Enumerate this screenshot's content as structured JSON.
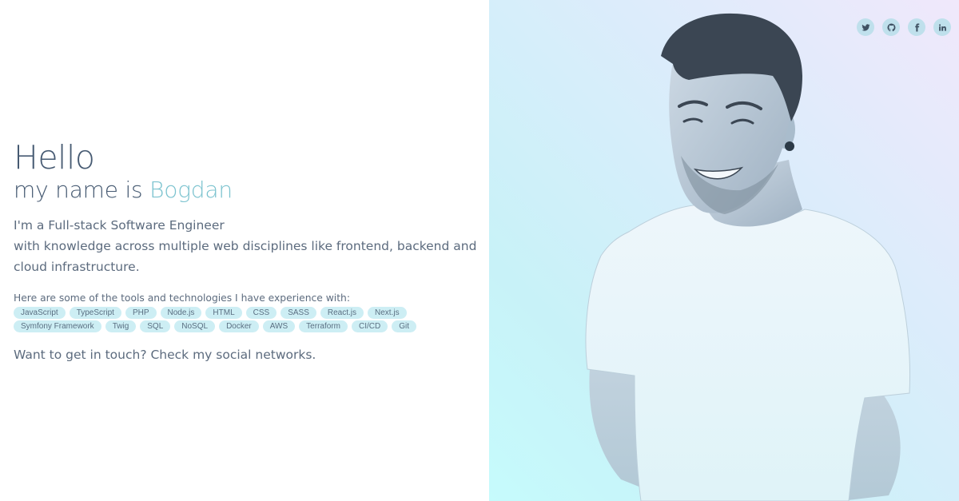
{
  "hero": {
    "hello": "Hello",
    "name_prefix": "my name is",
    "name": "Bogdan",
    "role_line": "I'm a Full-stack Software Engineer",
    "desc_line": "with knowledge across multiple web disciplines like frontend, backend and cloud infrastructure.",
    "tools_label": "Here are some of the tools and technologies I have experience with:",
    "tags": [
      "JavaScript",
      "TypeScript",
      "PHP",
      "Node.js",
      "HTML",
      "CSS",
      "SASS",
      "React.js",
      "Next.js",
      "Symfony Framework",
      "Twig",
      "SQL",
      "NoSQL",
      "Docker",
      "AWS",
      "Terraform",
      "CI/CD",
      "Git"
    ],
    "contact": "Want to get in touch? Check my social networks."
  },
  "socials": [
    {
      "name": "twitter-icon",
      "label": "Twitter"
    },
    {
      "name": "github-icon",
      "label": "GitHub"
    },
    {
      "name": "facebook-icon",
      "label": "Facebook"
    },
    {
      "name": "linkedin-icon",
      "label": "LinkedIn"
    }
  ],
  "colors": {
    "accent": "#7cc3cf",
    "heading": "#465a72",
    "tag_bg": "#cdeef4"
  }
}
